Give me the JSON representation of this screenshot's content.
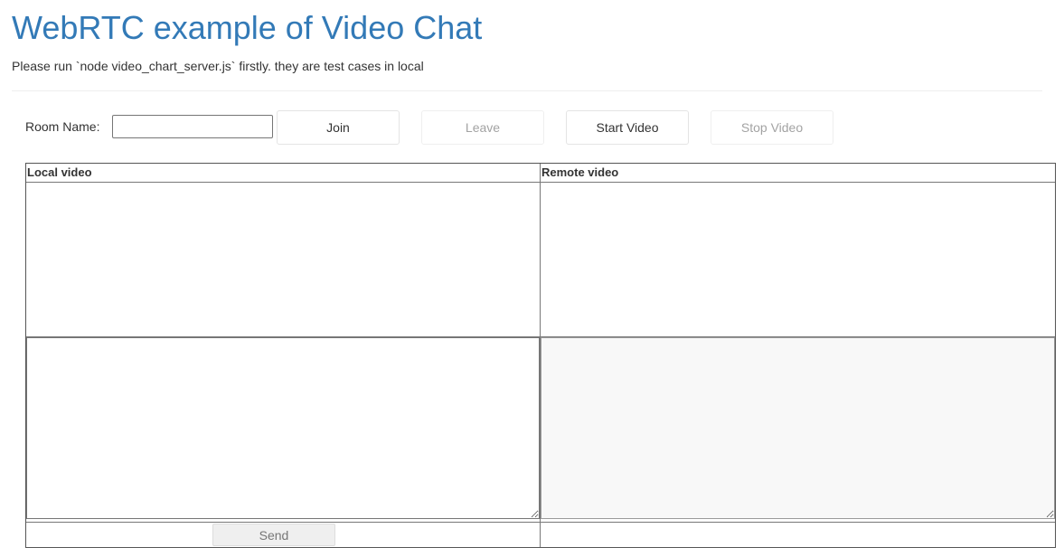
{
  "header": {
    "title": "WebRTC example of Video Chat",
    "subtitle": "Please run `node video_chart_server.js` firstly. they are test cases in local"
  },
  "controls": {
    "room_label": "Room Name:",
    "room_value": "",
    "room_placeholder": "",
    "join_label": "Join",
    "leave_label": "Leave",
    "start_video_label": "Start Video",
    "stop_video_label": "Stop Video"
  },
  "table": {
    "local_header": "Local video",
    "remote_header": "Remote video",
    "send_label": "Send"
  }
}
